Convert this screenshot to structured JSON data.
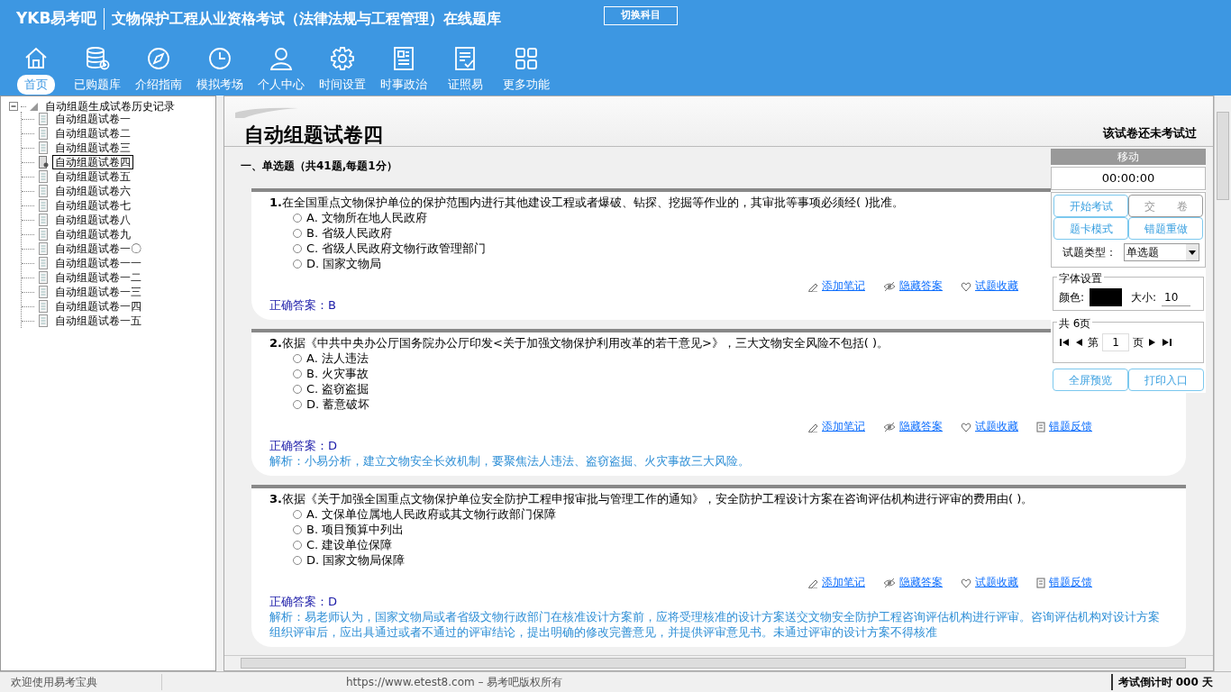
{
  "header": {
    "logo": "YKB易考吧",
    "title": "文物保护工程从业资格考试（法律法规与工程管理）在线题库",
    "switch_button": "切换科目",
    "nav": [
      {
        "label": "首页",
        "kind": "home",
        "selected": true
      },
      {
        "label": "已购题库",
        "kind": "database",
        "selected": false
      },
      {
        "label": "介绍指南",
        "kind": "compass",
        "selected": false
      },
      {
        "label": "模拟考场",
        "kind": "clock",
        "selected": false
      },
      {
        "label": "个人中心",
        "kind": "person",
        "selected": false
      },
      {
        "label": "时间设置",
        "kind": "gear",
        "selected": false
      },
      {
        "label": "时事政治",
        "kind": "news",
        "selected": false
      },
      {
        "label": "证照易",
        "kind": "checklist",
        "selected": false
      },
      {
        "label": "更多功能",
        "kind": "grid",
        "selected": false
      }
    ]
  },
  "tree": {
    "label": "自动组题生成试卷历史记录",
    "expanded": true,
    "children": [
      {
        "label": "自动组题试卷一",
        "selected": false
      },
      {
        "label": "自动组题试卷二",
        "selected": false
      },
      {
        "label": "自动组题试卷三",
        "selected": false
      },
      {
        "label": "自动组题试卷四",
        "selected": true
      },
      {
        "label": "自动组题试卷五",
        "selected": false
      },
      {
        "label": "自动组题试卷六",
        "selected": false
      },
      {
        "label": "自动组题试卷七",
        "selected": false
      },
      {
        "label": "自动组题试卷八",
        "selected": false
      },
      {
        "label": "自动组题试卷九",
        "selected": false
      },
      {
        "label": "自动组题试卷一〇",
        "selected": false
      },
      {
        "label": "自动组题试卷一一",
        "selected": false
      },
      {
        "label": "自动组题试卷一二",
        "selected": false
      },
      {
        "label": "自动组题试卷一三",
        "selected": false
      },
      {
        "label": "自动组题试卷一四",
        "selected": false
      },
      {
        "label": "自动组题试卷一五",
        "selected": false
      }
    ]
  },
  "paper": {
    "title": "自动组题试卷四",
    "status": "该试卷还未考试过",
    "section": "一、单选题（共41题,每题1分）",
    "questions": [
      {
        "number": "1.",
        "text": "在全国重点文物保护单位的保护范围内进行其他建设工程或者爆破、钻探、挖掘等作业的，其审批等事项必须经( )批准。",
        "options": [
          {
            "letter": "A.",
            "text": "文物所在地人民政府",
            "selected": false
          },
          {
            "letter": "B.",
            "text": "省级人民政府",
            "selected": false
          },
          {
            "letter": "C.",
            "text": "省级人民政府文物行政管理部门",
            "selected": false
          },
          {
            "letter": "D.",
            "text": "国家文物局",
            "selected": false
          }
        ],
        "actions": [
          "添加笔记",
          "隐藏答案",
          "试题收藏"
        ],
        "answer_label": "正确答案：",
        "answer": "B"
      },
      {
        "number": "2.",
        "text": "依据《中共中央办公厅国务院办公厅印发<关于加强文物保护利用改革的若干意见>》，三大文物安全风险不包括( )。",
        "options": [
          {
            "letter": "A.",
            "text": "法人违法",
            "selected": false
          },
          {
            "letter": "B.",
            "text": "火灾事故",
            "selected": false
          },
          {
            "letter": "C.",
            "text": "盗窃盗掘",
            "selected": false
          },
          {
            "letter": "D.",
            "text": "蓄意破坏",
            "selected": false
          }
        ],
        "actions": [
          "添加笔记",
          "隐藏答案",
          "试题收藏",
          "错题反馈"
        ],
        "answer_label": "正确答案：",
        "answer": "D",
        "analysis": "解析：小易分析，建立文物安全长效机制，要聚焦法人违法、盗窃盗掘、火灾事故三大风险。"
      },
      {
        "number": "3.",
        "text": "依据《关于加强全国重点文物保护单位安全防护工程申报审批与管理工作的通知》，安全防护工程设计方案在咨询评估机构进行评审的费用由( )。",
        "options": [
          {
            "letter": "A.",
            "text": "文保单位属地人民政府或其文物行政部门保障",
            "selected": false
          },
          {
            "letter": "B.",
            "text": "项目预算中列出",
            "selected": false
          },
          {
            "letter": "C.",
            "text": "建设单位保障",
            "selected": false
          },
          {
            "letter": "D.",
            "text": "国家文物局保障",
            "selected": false
          }
        ],
        "actions": [
          "添加笔记",
          "隐藏答案",
          "试题收藏",
          "错题反馈"
        ],
        "answer_label": "正确答案：",
        "answer": "D",
        "analysis": "解析：易老师认为，国家文物局或者省级文物行政部门在核准设计方案前，应将受理核准的设计方案送交文物安全防护工程咨询评估机构进行评审。咨询评估机构对设计方案组织评审后，应出具通过或者不通过的评审结论，提出明确的修改完善意见，并提供评审意见书。未通过评审的设计方案不得核准"
      }
    ]
  },
  "side_panel": {
    "header": "移动",
    "timer": "00:00:00",
    "buttons": [
      {
        "label": "开始考试",
        "disabled": false
      },
      {
        "label": "交　　卷",
        "disabled": true
      },
      {
        "label": "题卡模式",
        "disabled": false
      },
      {
        "label": "错题重做",
        "disabled": false
      }
    ],
    "type_label": "试题类型：",
    "type_value": "单选题",
    "font_group": "字体设置",
    "color_label": "颜色:",
    "size_label": "大小:",
    "size_value": "10",
    "pages_group": "共 6页",
    "page_prefix": "第",
    "page_value": "1",
    "page_suffix": "页",
    "bottom_buttons": [
      "全屏预览",
      "打印入口"
    ]
  },
  "status_bar": {
    "welcome": "欢迎使用易考宝典",
    "copyright": "https://www.etest8.com – 易考吧版权所有",
    "countdown": "考试倒计时 000 天"
  }
}
